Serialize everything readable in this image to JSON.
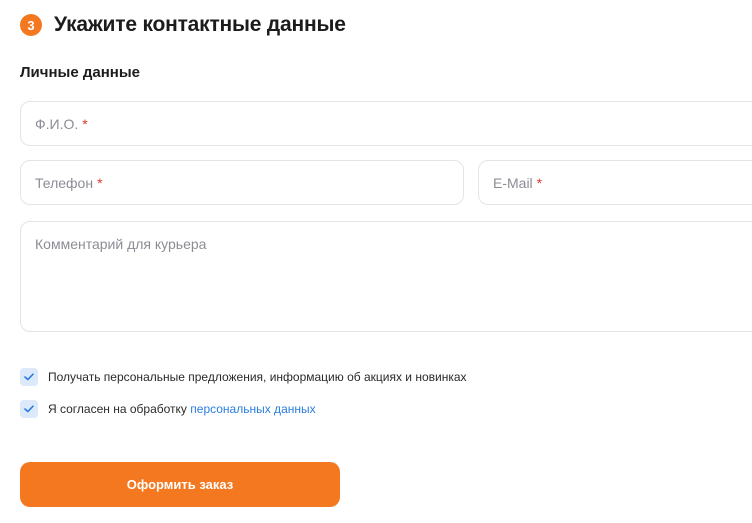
{
  "step": {
    "number": "3",
    "title": "Укажите контактные данные"
  },
  "section": {
    "title": "Личные данные"
  },
  "fields": {
    "fio": {
      "placeholder": "Ф.И.О.",
      "required_mark": "*"
    },
    "phone": {
      "placeholder": "Телефон",
      "required_mark": "*"
    },
    "email": {
      "placeholder": "E-Mail",
      "required_mark": "*"
    },
    "comment": {
      "placeholder": "Комментарий для курьера"
    }
  },
  "checkboxes": {
    "offers": {
      "label": "Получать персональные предложения, информацию об акциях и новинках",
      "checked": true
    },
    "consent": {
      "label": "Я согласен на обработку ",
      "link": "персональных данных",
      "checked": true
    }
  },
  "submit": {
    "label": "Оформить заказ"
  },
  "colors": {
    "accent": "#f47820",
    "link": "#2b7de0",
    "required": "#e0392f",
    "checkbox_bg": "#dce9fb"
  }
}
